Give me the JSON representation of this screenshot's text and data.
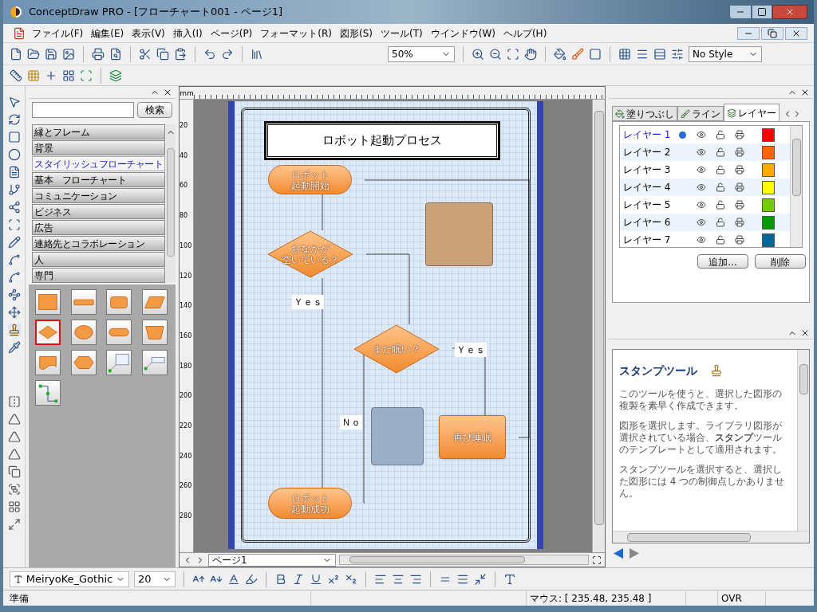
{
  "window": {
    "title": "ConceptDraw PRO - [フローチャート001 - ページ1]"
  },
  "menu": [
    "ファイル(F)",
    "編集(E)",
    "表示(V)",
    "挿入(I)",
    "ページ(P)",
    "フォーマット(R)",
    "図形(S)",
    "ツール(T)",
    "ウインドウ(W)",
    "ヘルプ(H)"
  ],
  "toolbar": {
    "zoom": "50%",
    "style": "No Style"
  },
  "library": {
    "search_button": "検索",
    "categories": [
      {
        "label": "縁とフレーム",
        "selected": false
      },
      {
        "label": "背景",
        "selected": false
      },
      {
        "label": "スタイリッシュフローチャート",
        "selected": true
      },
      {
        "label": "基本　フローチャート",
        "selected": false
      },
      {
        "label": "コミュニケーション",
        "selected": false
      },
      {
        "label": "ビジネス",
        "selected": false
      },
      {
        "label": "広告",
        "selected": false
      },
      {
        "label": "連絡先とコラボレーション",
        "selected": false
      },
      {
        "label": "人",
        "selected": false
      },
      {
        "label": "専門",
        "selected": false
      }
    ],
    "shapes": [
      {
        "kind": "rect",
        "selected": false
      },
      {
        "kind": "bar",
        "selected": false
      },
      {
        "kind": "rounded",
        "selected": false
      },
      {
        "kind": "parallelogram",
        "selected": false
      },
      {
        "kind": "diamond",
        "selected": true
      },
      {
        "kind": "ellipse",
        "selected": false
      },
      {
        "kind": "pill",
        "selected": false
      },
      {
        "kind": "trapezoid",
        "selected": false
      },
      {
        "kind": "document",
        "selected": false
      },
      {
        "kind": "hexagon",
        "selected": false
      },
      {
        "kind": "callout",
        "selected": false
      },
      {
        "kind": "callout-line",
        "selected": false
      },
      {
        "kind": "connector",
        "selected": false
      }
    ]
  },
  "canvas": {
    "ruler_unit": "mm",
    "ruler_marks": [
      "20",
      "40",
      "60",
      "80",
      "100",
      "120",
      "140",
      "160",
      "180",
      "200",
      "220",
      "240",
      "260",
      "280"
    ],
    "title": "ロボット起動プロセス",
    "nodes": [
      {
        "kind": "terminal",
        "lines": [
          "ロボット",
          "起動開始"
        ]
      },
      {
        "kind": "decision",
        "lines": [
          "おなかが",
          "空いている？"
        ]
      },
      {
        "kind": "decision",
        "lines": [
          "まだ眠い？"
        ]
      },
      {
        "kind": "process",
        "lines": [
          "再び睡眠"
        ]
      },
      {
        "kind": "terminal",
        "lines": [
          "ロボット",
          "起動成功"
        ]
      }
    ],
    "labels": [
      "Ｙｅｓ",
      "Ｙｅｓ",
      "Ｎｏ"
    ],
    "page_selector": "ページ1"
  },
  "properties": {
    "tabs": [
      {
        "label": "塗りつぶし",
        "selected": false
      },
      {
        "label": "ライン",
        "selected": false
      },
      {
        "label": "レイヤー",
        "selected": true
      }
    ],
    "layers": [
      {
        "name": "レイヤー 1",
        "current": true,
        "color": "#ff0000"
      },
      {
        "name": "レイヤー 2",
        "current": false,
        "color": "#ff6600"
      },
      {
        "name": "レイヤー 3",
        "current": false,
        "color": "#ffaa00"
      },
      {
        "name": "レイヤー 4",
        "current": false,
        "color": "#ffff00"
      },
      {
        "name": "レイヤー 5",
        "current": false,
        "color": "#77cc00"
      },
      {
        "name": "レイヤー 6",
        "current": false,
        "color": "#009900"
      },
      {
        "name": "レイヤー 7",
        "current": false,
        "color": "#006699"
      }
    ],
    "buttons": [
      "追加...",
      "削除"
    ]
  },
  "help": {
    "title": "スタンプツール",
    "paragraphs": [
      "このツールを使うと、選択した図形の複製を素早く作成できます。",
      "図形を選択します。ライブラリ図形が選択されている場合、**スタンプ**ツールのテンプレートとして適用されます。",
      "スタンプツールを選択すると、選択した図形には 4 つの制御点しかありません。"
    ]
  },
  "format_bar": {
    "font": "MeiryoKe_Gothic",
    "size": "20"
  },
  "status_bar": {
    "message": "準備",
    "mouse": "マウス: [ 235.48, 235.48 ]",
    "mode": "OVR"
  }
}
